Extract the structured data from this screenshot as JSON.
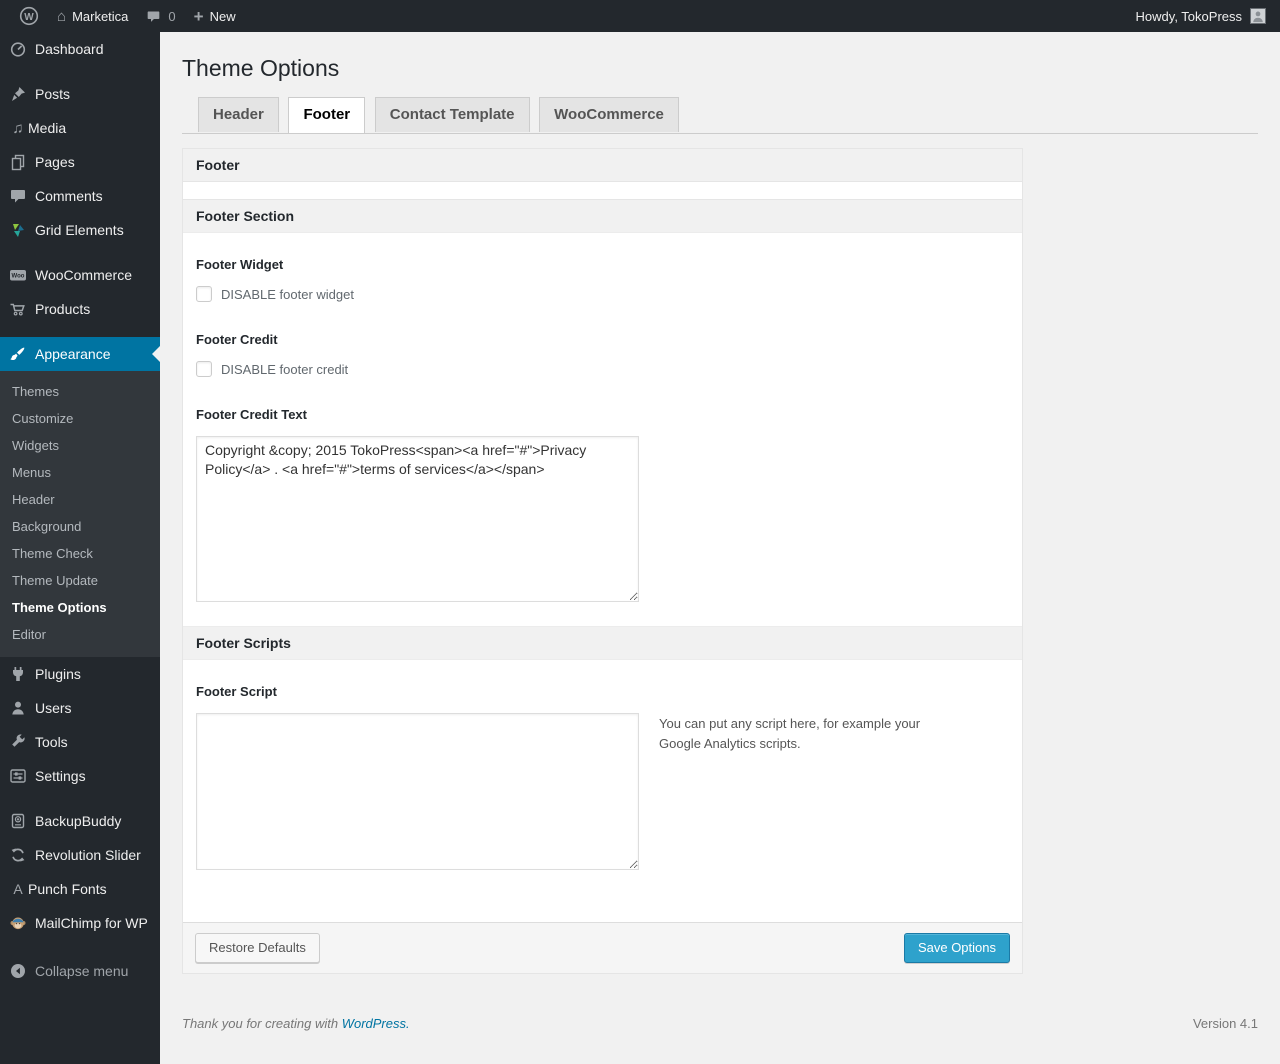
{
  "admin_bar": {
    "site_name": "Marketica",
    "comment_count": "0",
    "new_label": "New",
    "howdy_text": "Howdy, TokoPress"
  },
  "sidebar": {
    "items": [
      {
        "label": "Dashboard",
        "icon": "dashboard-icon"
      },
      {
        "label": "Posts",
        "icon": "pushpin-icon"
      },
      {
        "label": "Media",
        "icon": "media-icon"
      },
      {
        "label": "Pages",
        "icon": "pages-icon"
      },
      {
        "label": "Comments",
        "icon": "comments-icon"
      },
      {
        "label": "Grid Elements",
        "icon": "grid-elements-icon"
      },
      {
        "label": "WooCommerce",
        "icon": "woocommerce-icon"
      },
      {
        "label": "Products",
        "icon": "cart-icon"
      },
      {
        "label": "Appearance",
        "icon": "appearance-brush-icon",
        "active": true
      },
      {
        "label": "Plugins",
        "icon": "plugin-icon"
      },
      {
        "label": "Users",
        "icon": "users-icon"
      },
      {
        "label": "Tools",
        "icon": "tools-icon"
      },
      {
        "label": "Settings",
        "icon": "settings-icon"
      },
      {
        "label": "BackupBuddy",
        "icon": "backupbuddy-icon"
      },
      {
        "label": "Revolution Slider",
        "icon": "revolution-slider-icon"
      },
      {
        "label": "Punch Fonts",
        "icon": "punch-fonts-icon"
      },
      {
        "label": "MailChimp for WP",
        "icon": "mailchimp-icon"
      }
    ],
    "appearance_submenu": [
      "Themes",
      "Customize",
      "Widgets",
      "Menus",
      "Header",
      "Background",
      "Theme Check",
      "Theme Update",
      "Theme Options",
      "Editor"
    ],
    "current_submenu_item": "Theme Options",
    "collapse_label": "Collapse menu"
  },
  "main": {
    "page_title": "Theme Options",
    "tabs": [
      {
        "label": "Header",
        "active": false
      },
      {
        "label": "Footer",
        "active": true
      },
      {
        "label": "Contact Template",
        "active": false
      },
      {
        "label": "WooCommerce",
        "active": false
      }
    ],
    "panel": {
      "box_title": "Footer",
      "section_footer_title": "Footer Section",
      "footer_widget_label": "Footer Widget",
      "footer_widget_checkbox_label": "DISABLE footer widget",
      "footer_widget_checked": false,
      "footer_credit_label": "Footer Credit",
      "footer_credit_checkbox_label": "DISABLE footer credit",
      "footer_credit_checked": false,
      "footer_credit_text_label": "Footer Credit Text",
      "footer_credit_text_value": "Copyright &copy; 2015 TokoPress<span><a href=\"#\">Privacy Policy</a> . <a href=\"#\">terms of services</a></span>",
      "section_scripts_title": "Footer Scripts",
      "footer_script_label": "Footer Script",
      "footer_script_value": "",
      "footer_script_help": "You can put any script here, for example your Google Analytics scripts.",
      "restore_button_label": "Restore Defaults",
      "save_button_label": "Save Options"
    }
  },
  "page_footer": {
    "thanks_prefix": "Thank you for creating with ",
    "wordpress_link_label": "WordPress.",
    "version_label": "Version 4.1"
  },
  "colors": {
    "admin_accent_blue": "#0074a2",
    "primary_button_blue": "#2ea2cc",
    "sidebar_background": "#23282d",
    "link_blue": "#0074a2"
  }
}
